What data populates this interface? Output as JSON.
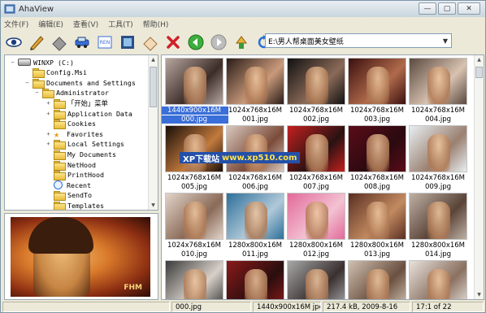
{
  "window": {
    "title": "AhaView",
    "minimize_glyph": "—",
    "maximize_glyph": "▢",
    "close_glyph": "✕"
  },
  "menu": [
    {
      "label": "文件(F)"
    },
    {
      "label": "编辑(E)"
    },
    {
      "label": "查看(V)"
    },
    {
      "label": "工具(T)"
    },
    {
      "label": "帮助(H)"
    }
  ],
  "toolbar": {
    "icons": [
      "eye-icon",
      "pencil-icon",
      "eraser-icon",
      "car-icon",
      "convert-icon",
      "filmstrip-icon",
      "rotate-icon",
      "delete-icon",
      "back-icon",
      "forward-icon",
      "up-icon",
      "refresh-icon"
    ],
    "path": "E:\\男人帮桌面美女壁纸"
  },
  "tree": {
    "items": [
      {
        "label": "WINXP (C:)",
        "icon": "drive-icon",
        "expander": "−"
      },
      {
        "label": "Config.Msi",
        "icon": "folder-icon",
        "expander": ""
      },
      {
        "label": "Documents and Settings",
        "icon": "folder-icon",
        "expander": "−"
      },
      {
        "label": "Administrator",
        "icon": "folder-icon",
        "expander": "−"
      },
      {
        "label": "「开始」菜单",
        "icon": "folder-icon",
        "expander": "+"
      },
      {
        "label": "Application Data",
        "icon": "folder-icon",
        "expander": "+"
      },
      {
        "label": "Cookies",
        "icon": "folder-icon",
        "expander": ""
      },
      {
        "label": "Favorites",
        "icon": "star-folder-icon",
        "expander": "+"
      },
      {
        "label": "Local Settings",
        "icon": "folder-icon",
        "expander": "+"
      },
      {
        "label": "My Documents",
        "icon": "folder-icon",
        "expander": ""
      },
      {
        "label": "NetHood",
        "icon": "folder-icon",
        "expander": ""
      },
      {
        "label": "PrintHood",
        "icon": "folder-icon",
        "expander": ""
      },
      {
        "label": "Recent",
        "icon": "clock-folder-icon",
        "expander": ""
      },
      {
        "label": "SendTo",
        "icon": "folder-icon",
        "expander": ""
      },
      {
        "label": "Templates",
        "icon": "folder-icon",
        "expander": ""
      }
    ]
  },
  "preview": {
    "watermark_text": "FHM"
  },
  "thumbnails": [
    {
      "res": "1440x900x16M",
      "name": "000.jpg",
      "selected": true,
      "c1": "#b7a6a0",
      "c2": "#3d2d28"
    },
    {
      "res": "1024x768x16M",
      "name": "001.jpg",
      "selected": false,
      "c1": "#2a1d18",
      "c2": "#c99a7b"
    },
    {
      "res": "1024x768x16M",
      "name": "002.jpg",
      "selected": false,
      "c1": "#111111",
      "c2": "#8a6a58"
    },
    {
      "res": "1024x768x16M",
      "name": "003.jpg",
      "selected": false,
      "c1": "#3b1010",
      "c2": "#b06a4a"
    },
    {
      "res": "1024x768x16M",
      "name": "004.jpg",
      "selected": false,
      "c1": "#5a4a40",
      "c2": "#d8c2b0"
    },
    {
      "res": "1024x768x16M",
      "name": "005.jpg",
      "selected": false,
      "c1": "#1a0f0a",
      "c2": "#c27a3c"
    },
    {
      "res": "1024x768x16M",
      "name": "006.jpg",
      "selected": false,
      "c1": "#d8c8bd",
      "c2": "#7b4b3a"
    },
    {
      "res": "1024x768x16M",
      "name": "007.jpg",
      "selected": false,
      "c1": "#c42020",
      "c2": "#2a1212"
    },
    {
      "res": "1024x768x16M",
      "name": "008.jpg",
      "selected": false,
      "c1": "#5a0c18",
      "c2": "#2b0a10"
    },
    {
      "res": "1024x768x16M",
      "name": "009.jpg",
      "selected": false,
      "c1": "#e8eef2",
      "c2": "#9a8070"
    },
    {
      "res": "1024x768x16M",
      "name": "010.jpg",
      "selected": false,
      "c1": "#e2d4c8",
      "c2": "#8a6a58"
    },
    {
      "res": "1280x800x16M",
      "name": "011.jpg",
      "selected": false,
      "c1": "#2e6f9a",
      "c2": "#b0c9d8"
    },
    {
      "res": "1280x800x16M",
      "name": "012.jpg",
      "selected": false,
      "c1": "#e26a9a",
      "c2": "#f3c2d2"
    },
    {
      "res": "1280x800x16M",
      "name": "013.jpg",
      "selected": false,
      "c1": "#5a2f22",
      "c2": "#c28a60"
    },
    {
      "res": "1280x800x16M",
      "name": "014.jpg",
      "selected": false,
      "c1": "#bfb0a4",
      "c2": "#5a4438"
    },
    {
      "res": "",
      "name": "",
      "selected": false,
      "c1": "#3a3a3a",
      "c2": "#d8d0c8"
    },
    {
      "res": "",
      "name": "",
      "selected": false,
      "c1": "#8a1a1a",
      "c2": "#2a0e0e"
    },
    {
      "res": "",
      "name": "",
      "selected": false,
      "c1": "#a8a8a8",
      "c2": "#3a3030"
    },
    {
      "res": "",
      "name": "",
      "selected": false,
      "c1": "#d0c0b0",
      "c2": "#6a5040"
    },
    {
      "res": "",
      "name": "",
      "selected": false,
      "c1": "#e8e2dc",
      "c2": "#8a7060"
    }
  ],
  "watermark": {
    "part1": "XP下载站",
    "part2": "www.xp510.com"
  },
  "status": {
    "filename": "000.jpg",
    "info": "1440x900x16M jpeg",
    "size_date": "217.4 kB, 2009-8-16",
    "position": "17:1 of 22"
  }
}
